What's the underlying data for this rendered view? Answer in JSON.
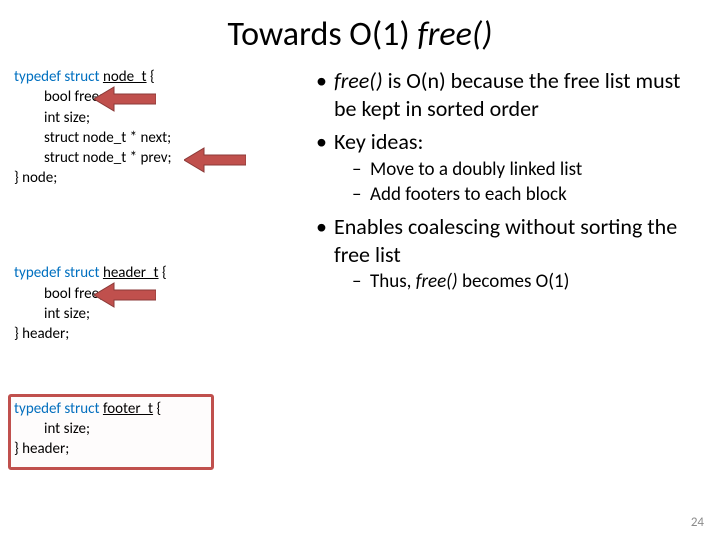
{
  "title_pre": "Towards O(1) ",
  "title_ital": "free()",
  "code": {
    "block1": {
      "l1a": "typedef struct ",
      "l1b": "node_t",
      "l1c": " {",
      "l2": "bool free;",
      "l3": "int size;",
      "l4": "struct node_t * next;",
      "l5": "struct node_t * prev;",
      "l6": "} node;"
    },
    "block2": {
      "l1a": "typedef struct ",
      "l1b": "header_t",
      "l1c": " {",
      "l2": "bool free;",
      "l3": "int size;",
      "l4": "} header;"
    },
    "block3": {
      "l1a": "typedef struct ",
      "l1b": "footer_t",
      "l1c": " {",
      "l2": "int size;",
      "l3": "} header;"
    }
  },
  "bullets": {
    "b1_pre": "",
    "b1_ital": "free()",
    "b1_post": " is O(n) because the free list must be kept in sorted order",
    "b2": "Key ideas:",
    "b2s1": "Move to a doubly linked list",
    "b2s2": "Add footers to each block",
    "b3": "Enables coalescing without sorting the free list",
    "b3s1_pre": "Thus, ",
    "b3s1_ital": "free()",
    "b3s1_post": " becomes O(1)"
  },
  "pagenum": "24"
}
